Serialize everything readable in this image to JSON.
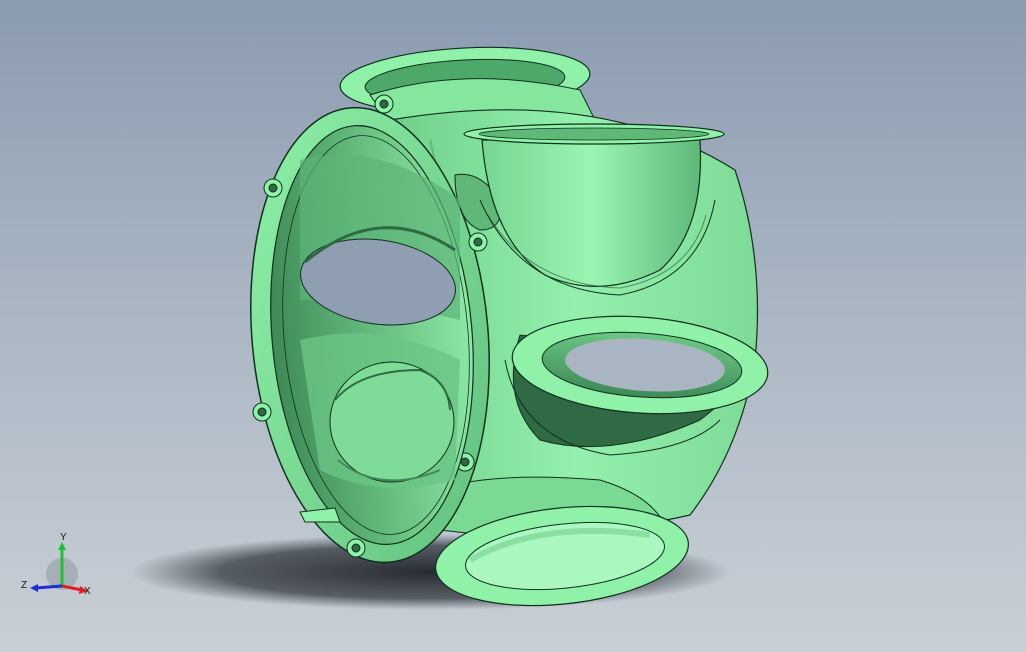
{
  "viewport": {
    "model_colors": {
      "base": "#8ff2a8",
      "light": "#a6f7bd",
      "mid": "#72d48e",
      "shade": "#4da86a",
      "dark": "#2f6a44",
      "edge": "#10301c"
    },
    "shadow_color": "#1f2329"
  },
  "triad": {
    "x_label": "X",
    "y_label": "Y",
    "z_label": "Z",
    "x_color": "#e02020",
    "y_color": "#20c030",
    "z_color": "#2030d0"
  }
}
